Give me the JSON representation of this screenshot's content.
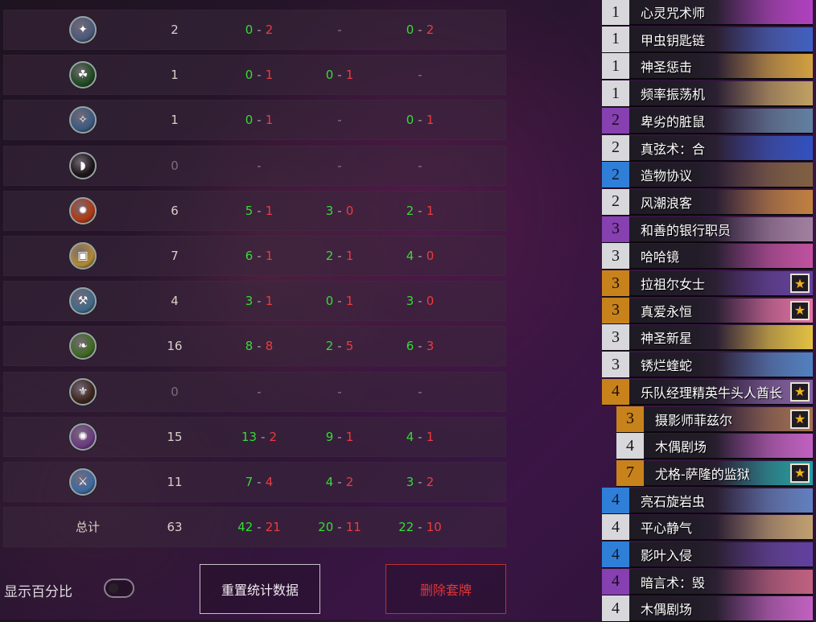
{
  "stats": {
    "rows": [
      {
        "icon": "gear-staff-icon",
        "glyph": "✦",
        "bg": "#4a5a7a",
        "total": "2",
        "a": [
          "0",
          "2"
        ],
        "b": null,
        "c": [
          "0",
          "2"
        ]
      },
      {
        "icon": "green-snake-icon",
        "glyph": "☘",
        "bg": "#1e4a1e",
        "total": "1",
        "a": [
          "0",
          "1"
        ],
        "b": [
          "0",
          "1"
        ],
        "c": null
      },
      {
        "icon": "blue-claw-icon",
        "glyph": "✧",
        "bg": "#3a5a80",
        "total": "1",
        "a": [
          "0",
          "1"
        ],
        "b": null,
        "c": [
          "0",
          "1"
        ]
      },
      {
        "icon": "dark-bow-icon",
        "glyph": "◗",
        "bg": "#1a1416",
        "total": "0",
        "a": null,
        "b": null,
        "c": null
      },
      {
        "icon": "fire-arrow-icon",
        "glyph": "✹",
        "bg": "#b03810",
        "total": "6",
        "a": [
          "5",
          "1"
        ],
        "b": [
          "3",
          "0"
        ],
        "c": [
          "2",
          "1"
        ]
      },
      {
        "icon": "golden-tablet-icon",
        "glyph": "▣",
        "bg": "#b08a30",
        "total": "7",
        "a": [
          "6",
          "1"
        ],
        "b": [
          "2",
          "1"
        ],
        "c": [
          "4",
          "0"
        ]
      },
      {
        "icon": "silver-hammer-icon",
        "glyph": "⚒",
        "bg": "#3e6a86",
        "total": "4",
        "a": [
          "3",
          "1"
        ],
        "b": [
          "0",
          "1"
        ],
        "c": [
          "3",
          "0"
        ]
      },
      {
        "icon": "green-wing-icon",
        "glyph": "❧",
        "bg": "#3e6a20",
        "total": "16",
        "a": [
          "8",
          "8"
        ],
        "b": [
          "2",
          "5"
        ],
        "c": [
          "6",
          "3"
        ]
      },
      {
        "icon": "dark-crest-icon",
        "glyph": "⚜",
        "bg": "#3a241a",
        "total": "0",
        "a": null,
        "b": null,
        "c": null
      },
      {
        "icon": "purple-spark-icon",
        "glyph": "✺",
        "bg": "#6a3a80",
        "total": "15",
        "a": [
          "13",
          "2"
        ],
        "b": [
          "9",
          "1"
        ],
        "c": [
          "4",
          "1"
        ]
      },
      {
        "icon": "blue-sword-icon",
        "glyph": "⚔",
        "bg": "#3a6aa0",
        "total": "11",
        "a": [
          "7",
          "4"
        ],
        "b": [
          "4",
          "2"
        ],
        "c": [
          "3",
          "2"
        ]
      }
    ],
    "total_row": {
      "label": "总计",
      "total": "63",
      "a": [
        "42",
        "21"
      ],
      "b": [
        "20",
        "11"
      ],
      "c": [
        "22",
        "10"
      ]
    },
    "separator": "-",
    "empty": "-"
  },
  "controls": {
    "show_percent_label": "显示百分比",
    "reset_button": "重置统计数据",
    "delete_button": "删除套牌"
  },
  "deck": {
    "cards": [
      {
        "cost": "1",
        "rarity": "common",
        "name": "心灵咒术师",
        "star": false,
        "art": "#b040c0",
        "indent": 0
      },
      {
        "cost": "1",
        "rarity": "common",
        "name": "甲虫钥匙链",
        "star": false,
        "art": "#4060c0",
        "indent": 0
      },
      {
        "cost": "1",
        "rarity": "common",
        "name": "神圣惩击",
        "star": false,
        "art": "#d0a040",
        "indent": 0
      },
      {
        "cost": "1",
        "rarity": "common",
        "name": "频率振荡机",
        "star": false,
        "art": "#c0a060",
        "indent": 0
      },
      {
        "cost": "2",
        "rarity": "epic",
        "name": "卑劣的脏鼠",
        "star": false,
        "art": "#6080a0",
        "indent": 0
      },
      {
        "cost": "2",
        "rarity": "common",
        "name": "真弦术：合",
        "star": false,
        "art": "#3050c0",
        "indent": 0
      },
      {
        "cost": "2",
        "rarity": "rare",
        "name": "造物协议",
        "star": false,
        "art": "#806040",
        "indent": 0
      },
      {
        "cost": "2",
        "rarity": "common",
        "name": "风潮浪客",
        "star": false,
        "art": "#c08040",
        "indent": 0
      },
      {
        "cost": "3",
        "rarity": "epic",
        "name": "和善的银行职员",
        "star": false,
        "art": "#a080a0",
        "indent": 0
      },
      {
        "cost": "3",
        "rarity": "common",
        "name": "哈哈镜",
        "star": false,
        "art": "#c050a0",
        "indent": 0
      },
      {
        "cost": "3",
        "rarity": "legendary",
        "name": "拉祖尔女士",
        "star": true,
        "art": "#6040a0",
        "indent": 0
      },
      {
        "cost": "3",
        "rarity": "legendary",
        "name": "真爱永恒",
        "star": true,
        "art": "#e070a0",
        "indent": 0
      },
      {
        "cost": "3",
        "rarity": "common",
        "name": "神圣新星",
        "star": false,
        "art": "#e0c040",
        "indent": 0
      },
      {
        "cost": "3",
        "rarity": "common",
        "name": "锈烂蝰蛇",
        "star": false,
        "art": "#5080c0",
        "indent": 0
      },
      {
        "cost": "4",
        "rarity": "legendary",
        "name": "乐队经理精英牛头人酋长",
        "star": true,
        "art": "#8060a0",
        "indent": 0
      },
      {
        "cost": "3",
        "rarity": "legendary",
        "name": "摄影师菲兹尔",
        "star": true,
        "art": "#a07050",
        "indent": 18
      },
      {
        "cost": "4",
        "rarity": "common",
        "name": "木偶剧场",
        "star": false,
        "art": "#c060c0",
        "indent": 18
      },
      {
        "cost": "7",
        "rarity": "legendary",
        "name": "尤格-萨隆的监狱",
        "star": true,
        "art": "#20a0a0",
        "indent": 18
      },
      {
        "cost": "4",
        "rarity": "rare",
        "name": "亮石旋岩虫",
        "star": false,
        "art": "#6080c0",
        "indent": 0
      },
      {
        "cost": "4",
        "rarity": "common",
        "name": "平心静气",
        "star": false,
        "art": "#c0a070",
        "indent": 0
      },
      {
        "cost": "4",
        "rarity": "rare",
        "name": "影叶入侵",
        "star": false,
        "art": "#6040a0",
        "indent": 0
      },
      {
        "cost": "4",
        "rarity": "epic",
        "name": "暗言术：毁",
        "star": false,
        "art": "#c06080",
        "indent": 0
      },
      {
        "cost": "4",
        "rarity": "common",
        "name": "木偶剧场",
        "star": false,
        "art": "#c060c0",
        "indent": 0
      }
    ]
  }
}
